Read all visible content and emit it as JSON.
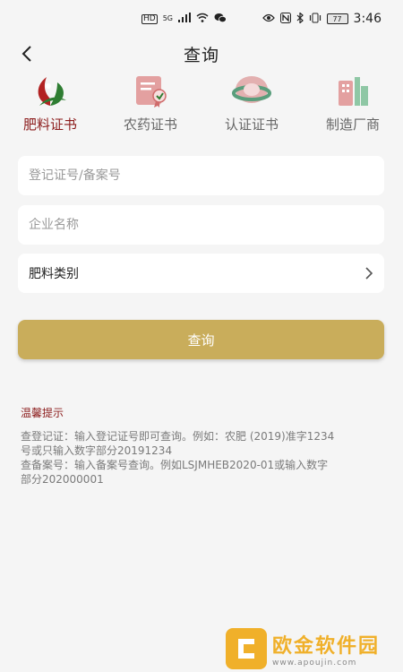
{
  "status_bar": {
    "left_icons": [
      "HD",
      "5G",
      "signal",
      "wifi",
      "wechat"
    ],
    "right_icons": [
      "eye",
      "nfc",
      "bluetooth",
      "vibrate"
    ],
    "battery": "77",
    "time": "3:46"
  },
  "nav": {
    "title": "查询"
  },
  "tabs": [
    {
      "label": "肥料证书",
      "icon": "fertilizer-leaf-icon",
      "active": true
    },
    {
      "label": "农药证书",
      "icon": "certificate-icon",
      "active": false
    },
    {
      "label": "认证证书",
      "icon": "seal-icon",
      "active": false
    },
    {
      "label": "制造厂商",
      "icon": "factory-building-icon",
      "active": false
    }
  ],
  "form": {
    "registration_placeholder": "登记证号/备案号",
    "company_placeholder": "企业名称",
    "category_value": "肥料类别",
    "submit_label": "查询"
  },
  "tips": {
    "title": "温馨提示",
    "line1": "查登记证：输入登记证号即可查询。例如：农肥 (2019)准字1234",
    "line2": "号或只输入数字部分20191234",
    "line3": "查备案号：输入备案号查询。例如LSJMHEB2020-01或输入数字",
    "line4": "部分202000001"
  },
  "watermark": {
    "name": "欧金软件园",
    "url": "www.apoujin.com"
  },
  "colors": {
    "accent": "#8c1c1c",
    "button": "#c9ad5b",
    "background": "#f5f5f5"
  }
}
